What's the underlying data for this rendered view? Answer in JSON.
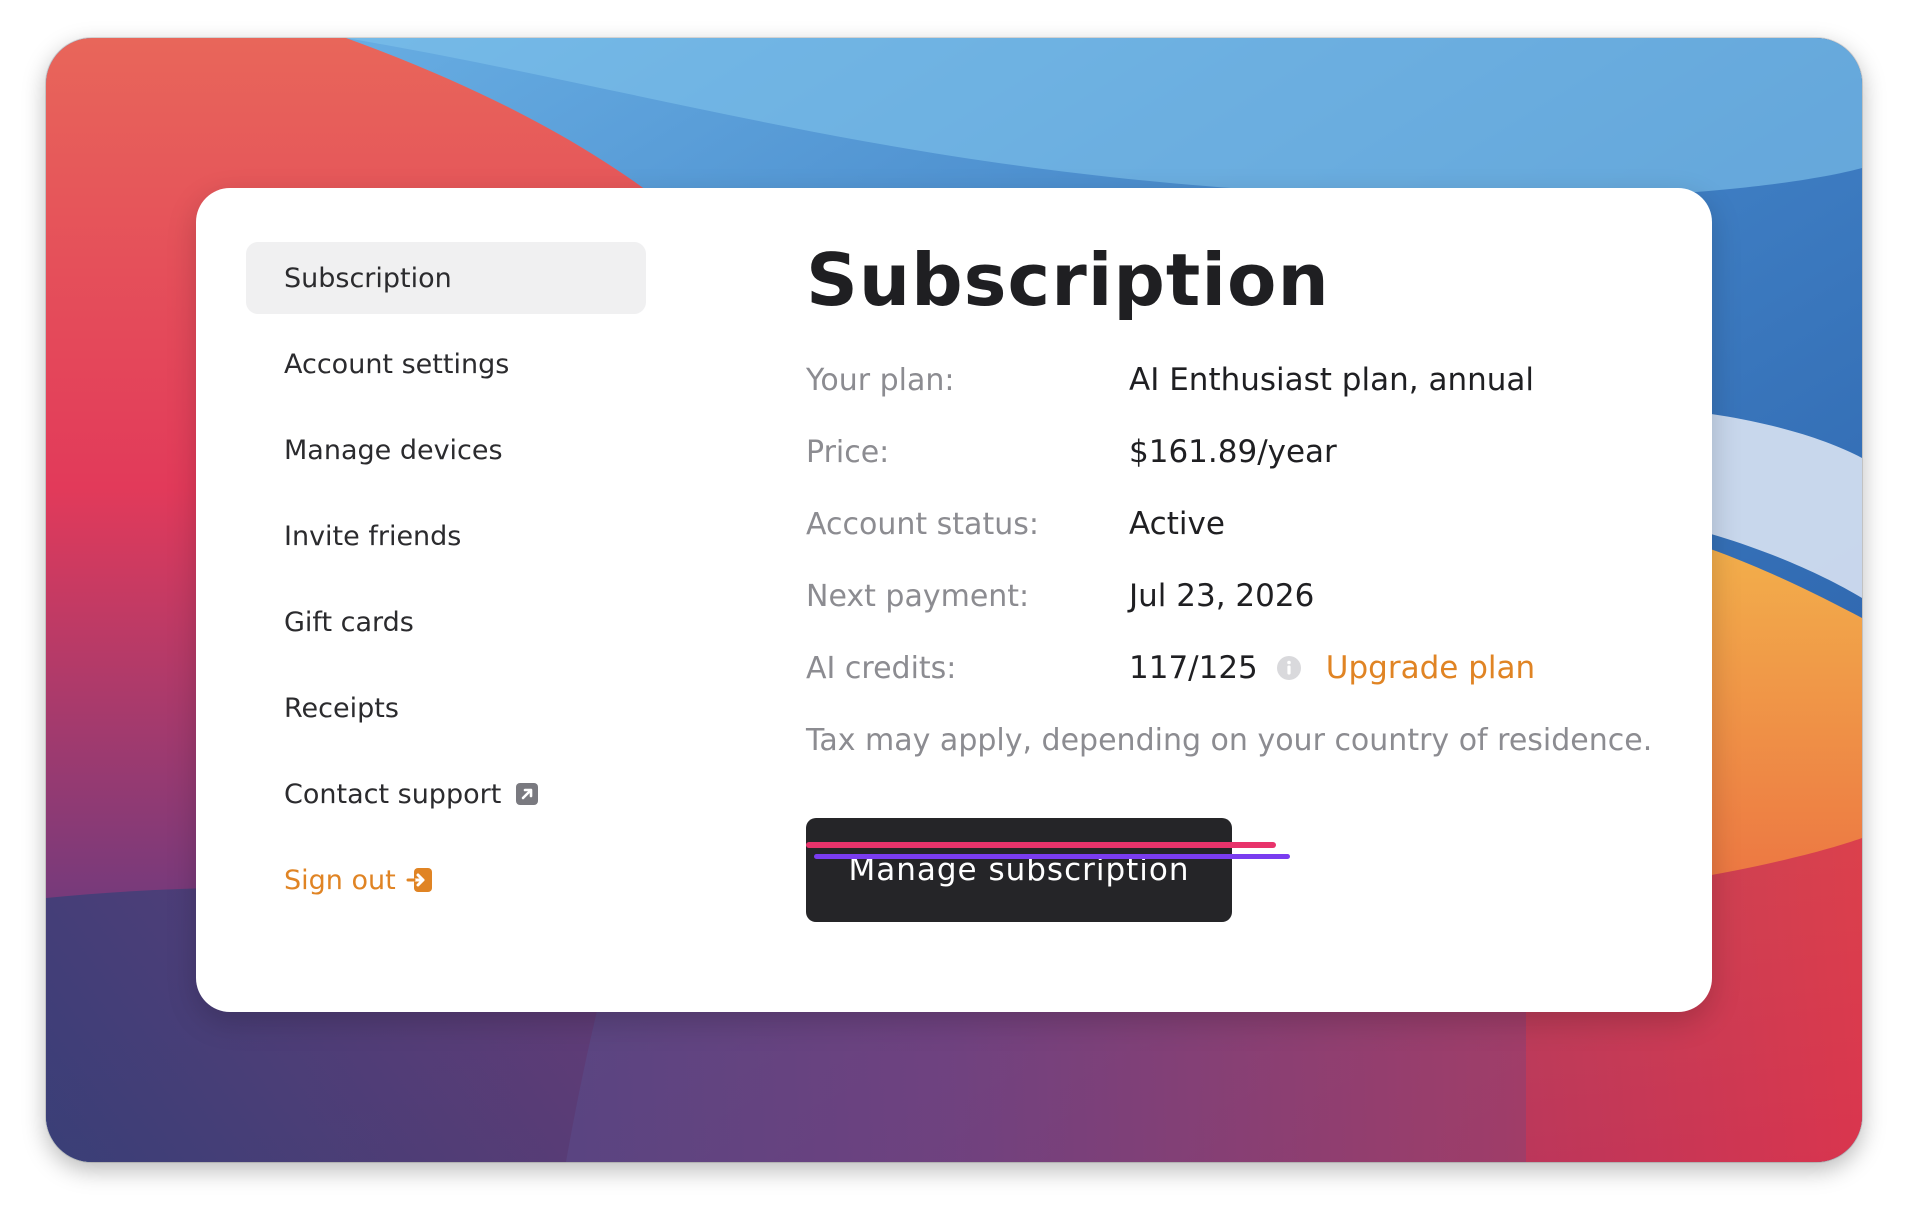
{
  "sidebar": {
    "items": [
      {
        "label": "Subscription",
        "active": true
      },
      {
        "label": "Account settings"
      },
      {
        "label": "Manage devices"
      },
      {
        "label": "Invite friends"
      },
      {
        "label": "Gift cards"
      },
      {
        "label": "Receipts"
      },
      {
        "label": "Contact support",
        "icon": "external-link-icon"
      },
      {
        "label": "Sign out",
        "icon": "sign-out-icon",
        "color": "#e08424"
      }
    ]
  },
  "main": {
    "title": "Subscription",
    "rows": [
      {
        "label": "Your plan:",
        "value": "AI Enthusiast plan, annual"
      },
      {
        "label": "Price:",
        "value": "$161.89/year"
      },
      {
        "label": "Account status:",
        "value": "Active"
      },
      {
        "label": "Next payment:",
        "value": "Jul 23, 2026"
      }
    ],
    "credits": {
      "label": "AI credits:",
      "value": "117/125",
      "info_icon": "info-icon",
      "upgrade_label": "Upgrade plan"
    },
    "tax_note": "Tax may apply, depending on your country of residence.",
    "button_label": "Manage subscription"
  },
  "colors": {
    "accent": "#e08424",
    "button_bg": "#252528",
    "underline_red": "#e8336b",
    "underline_purple": "#7a3cf0"
  }
}
